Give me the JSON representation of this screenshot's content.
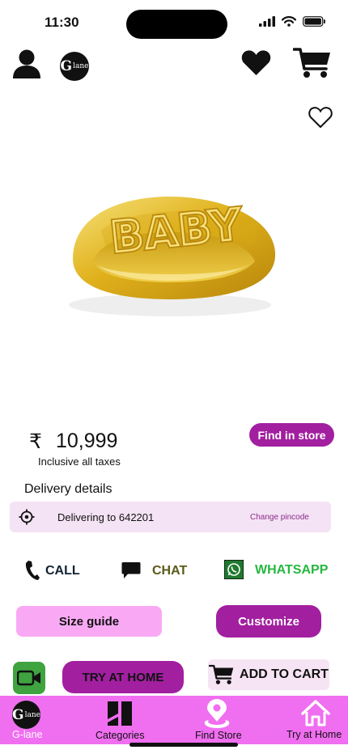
{
  "status": {
    "time": "11:30"
  },
  "header": {
    "logo_letter": "G",
    "logo_text": "lane",
    "icons": [
      "user-icon",
      "heart-icon",
      "cart-icon"
    ]
  },
  "product": {
    "ring_text": "BABY",
    "currency_symbol": "₹",
    "price": "10,999",
    "tax_note": "Inclusive all taxes",
    "find_store_label": "Find in store",
    "wishlist_icon": "heart-outline-icon"
  },
  "delivery": {
    "title": "Delivery details",
    "text": "Delivering to 642201",
    "change_label": "Change pincode"
  },
  "contact": {
    "call_label": "CALL",
    "chat_label": "CHAT",
    "whatsapp_label": "WHATSAPP"
  },
  "actions": {
    "size_guide_label": "Size guide",
    "customize_label": "Customize",
    "try_home_label": "TRY AT HOME",
    "add_cart_label": "ADD TO CART"
  },
  "nav": {
    "items": [
      {
        "label": "G-lane",
        "icon": "g-lane-logo-icon"
      },
      {
        "label": "Categories",
        "icon": "categories-icon"
      },
      {
        "label": "Find Store",
        "icon": "store-pin-icon"
      },
      {
        "label": "Try at Home",
        "icon": "home-icon"
      }
    ]
  },
  "colors": {
    "brand_purple": "#a21fa0",
    "nav_pink": "#f06ef0",
    "light_pink": "#f9a9f4",
    "pale_pink": "#f4e3f4",
    "whatsapp_green": "#25b840",
    "ring_gold": "#e5b820"
  }
}
